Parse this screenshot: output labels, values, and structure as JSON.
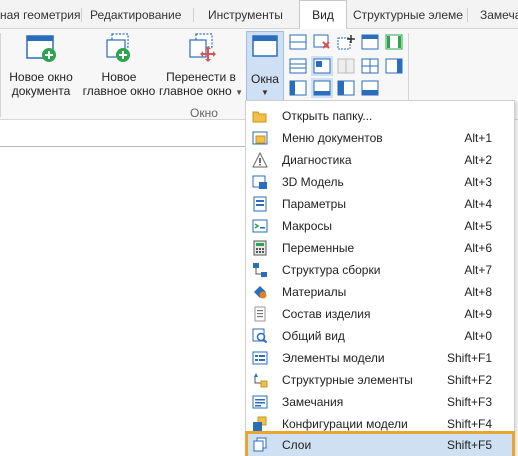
{
  "ribbon_tabs": [
    {
      "label": "ная геометрия"
    },
    {
      "label": "Редактирование"
    },
    {
      "label": "Инструменты"
    },
    {
      "label": "Вид",
      "active": true
    },
    {
      "label": "Структурные элеме"
    },
    {
      "label": "Замеча"
    }
  ],
  "window_group": {
    "label": "Окно",
    "new_doc_window": {
      "line1": "Новое окно",
      "line2": "документа"
    },
    "new_main_window": {
      "line1": "Новое",
      "line2": "главное окно"
    },
    "move_to_main": {
      "line1": "Перенести в",
      "line2": "главное окно"
    },
    "windows_button": {
      "label": "Окна"
    }
  },
  "menu": {
    "items": [
      {
        "label": "Открыть папку...",
        "shortcut": "",
        "icon": "folder-open-icon"
      },
      {
        "label": "Меню документов",
        "shortcut": "Alt+1",
        "icon": "documents-menu-icon"
      },
      {
        "label": "Диагностика",
        "shortcut": "Alt+2",
        "icon": "warning-icon"
      },
      {
        "label": "3D Модель",
        "shortcut": "Alt+3",
        "icon": "3d-model-icon"
      },
      {
        "label": "Параметры",
        "shortcut": "Alt+4",
        "icon": "parameters-icon"
      },
      {
        "label": "Макросы",
        "shortcut": "Alt+5",
        "icon": "macros-icon"
      },
      {
        "label": "Переменные",
        "shortcut": "Alt+6",
        "icon": "variables-icon"
      },
      {
        "label": "Структура сборки",
        "shortcut": "Alt+7",
        "icon": "assembly-structure-icon"
      },
      {
        "label": "Материалы",
        "shortcut": "Alt+8",
        "icon": "materials-icon"
      },
      {
        "label": "Состав изделия",
        "shortcut": "Alt+9",
        "icon": "product-composition-icon"
      },
      {
        "label": "Общий вид",
        "shortcut": "Alt+0",
        "icon": "general-view-icon"
      },
      {
        "label": "Элементы модели",
        "shortcut": "Shift+F1",
        "icon": "model-elements-icon"
      },
      {
        "label": "Структурные элементы",
        "shortcut": "Shift+F2",
        "icon": "structural-elements-icon"
      },
      {
        "label": "Замечания",
        "shortcut": "Shift+F3",
        "icon": "remarks-icon"
      },
      {
        "label": "Конфигурации модели",
        "shortcut": "Shift+F4",
        "icon": "model-configurations-icon"
      },
      {
        "label": "Слои",
        "shortcut": "Shift+F5",
        "icon": "layers-icon",
        "highlighted": true
      }
    ]
  },
  "colors": {
    "accent_blue": "#2a6ebb",
    "highlight_bg": "#cfe0f3",
    "highlight_border": "#e8a530",
    "green": "#2da44e"
  }
}
